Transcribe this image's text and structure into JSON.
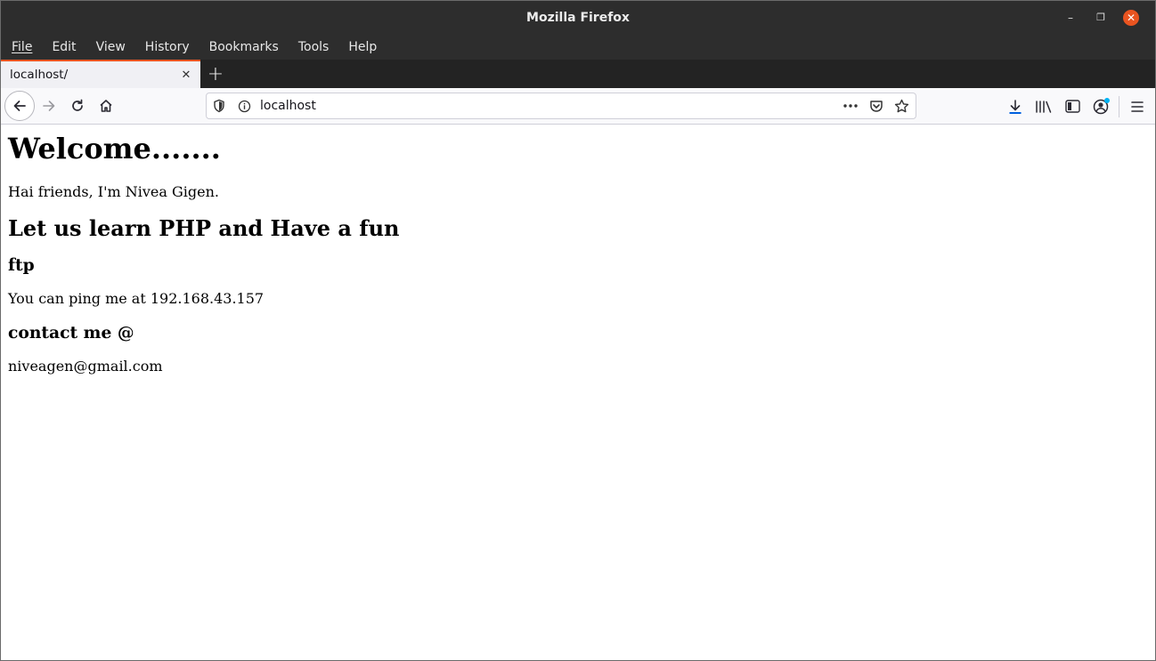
{
  "window": {
    "title": "Mozilla Firefox",
    "controls": {
      "minimize": "–",
      "restore": "❐",
      "close": "✕"
    }
  },
  "menubar": {
    "items": [
      {
        "label": "File"
      },
      {
        "label": "Edit"
      },
      {
        "label": "View"
      },
      {
        "label": "History"
      },
      {
        "label": "Bookmarks"
      },
      {
        "label": "Tools"
      },
      {
        "label": "Help"
      }
    ]
  },
  "tabs": {
    "active": {
      "title": "localhost/",
      "close": "✕"
    },
    "new_tab": "+"
  },
  "navbar": {
    "url": "localhost",
    "icons": [
      "back-icon",
      "forward-icon",
      "reload-icon",
      "home-icon",
      "shield-icon",
      "info-icon",
      "page-actions-icon",
      "pocket-icon",
      "bookmark-star-icon",
      "downloads-icon",
      "library-icon",
      "sidebar-icon",
      "account-icon",
      "menu-icon"
    ]
  },
  "page": {
    "heading": "Welcome.......",
    "intro": "Hai friends, I'm Nivea Gigen.",
    "subheading": "Let us learn PHP and Have a fun",
    "ftp_heading": "ftp",
    "ftp_text": "You can ping me at 192.168.43.157",
    "contact_heading": "contact me @",
    "contact_email": "niveagen@gmail.com"
  },
  "colors": {
    "titlebar": "#2d2d2d",
    "tab_accent": "#e95420",
    "close_button": "#e95420",
    "downloads_accent": "#0060df"
  }
}
